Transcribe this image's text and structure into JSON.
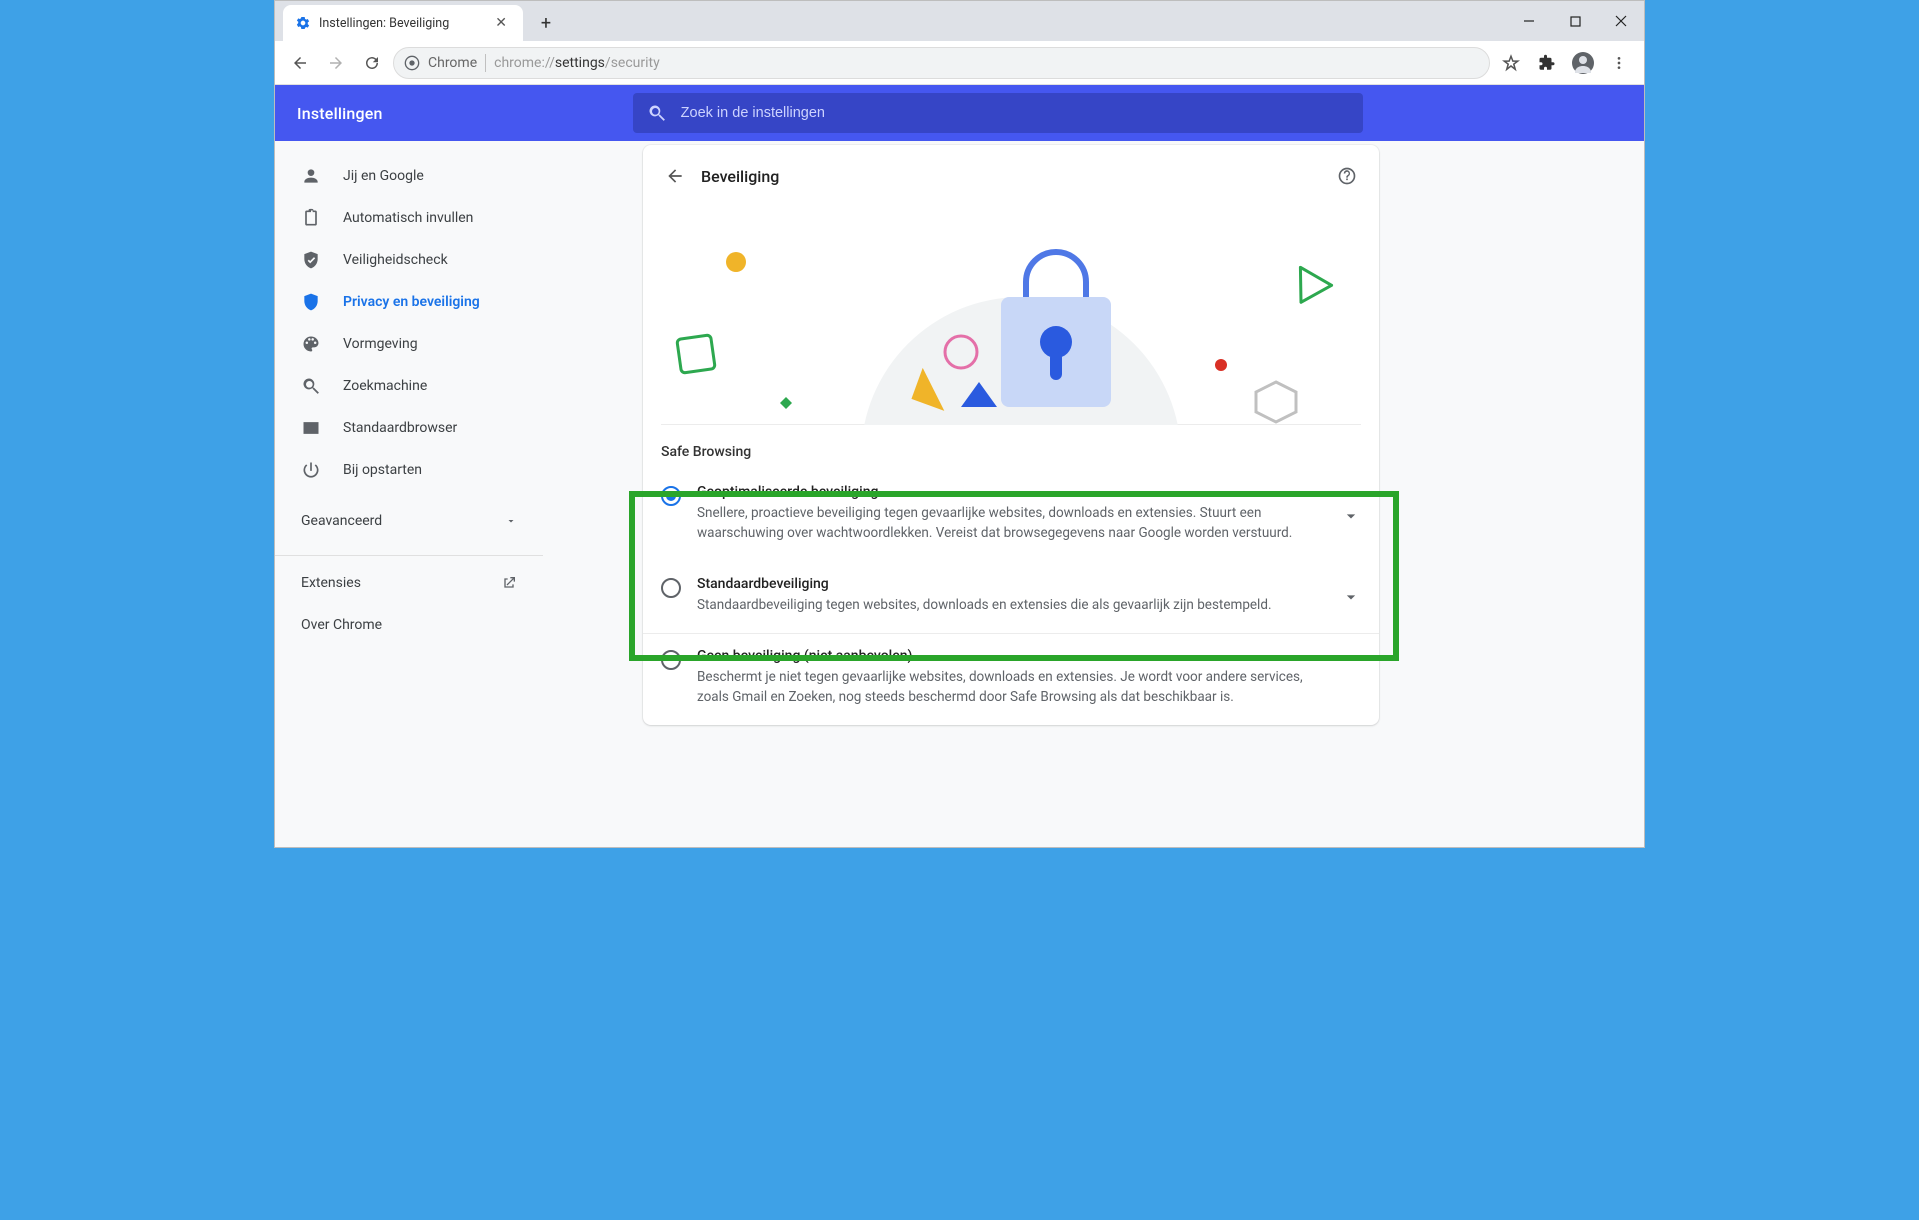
{
  "titlebar": {
    "tab_title": "Instellingen: Beveiliging"
  },
  "addressbar": {
    "chip": "Chrome",
    "url_pre": "chrome://",
    "url_bold": "settings",
    "url_post": "/security"
  },
  "settings": {
    "title": "Instellingen",
    "search_placeholder": "Zoek in de instellingen"
  },
  "sidebar": {
    "items": [
      "Jij en Google",
      "Automatisch invullen",
      "Veiligheidscheck",
      "Privacy en beveiliging",
      "Vormgeving",
      "Zoekmachine",
      "Standaardbrowser",
      "Bij opstarten"
    ],
    "advanced": "Geavanceerd",
    "extensions": "Extensies",
    "about": "Over Chrome"
  },
  "page": {
    "title": "Beveiliging",
    "safe_browsing_title": "Safe Browsing",
    "options": [
      {
        "title": "Geoptimaliseerde beveiliging",
        "desc": "Snellere, proactieve beveiliging tegen gevaarlijke websites, downloads en extensies. Stuurt een waarschuwing over wachtwoordlekken. Vereist dat browsegegevens naar Google worden verstuurd.",
        "selected": true,
        "expandable": true
      },
      {
        "title": "Standaardbeveiliging",
        "desc": "Standaardbeveiliging tegen websites, downloads en extensies die als gevaarlijk zijn bestempeld.",
        "selected": false,
        "expandable": true
      },
      {
        "title": "Geen beveiliging (niet aanbevolen)",
        "desc": "Beschermt je niet tegen gevaarlijke websites, downloads en extensies. Je wordt voor andere services, zoals Gmail en Zoeken, nog steeds beschermd door Safe Browsing als dat beschikbaar is.",
        "selected": false,
        "expandable": false
      }
    ]
  }
}
